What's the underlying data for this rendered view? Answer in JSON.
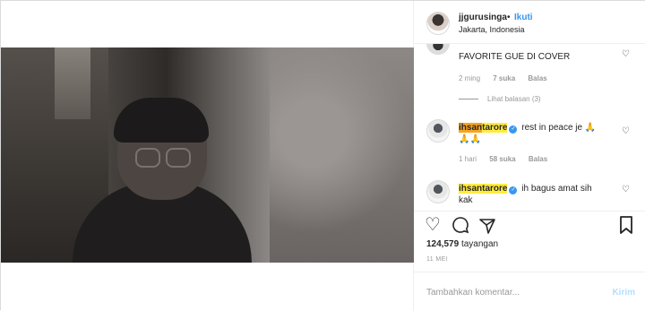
{
  "header": {
    "username": "jjgurusinga",
    "separator": "•",
    "follow_label": "Ikuti",
    "location": "Jakarta, Indonesia"
  },
  "comments": [
    {
      "text": "FAVORITE GUE DI COVER",
      "time": "2 ming",
      "likes": "7 suka",
      "reply": "Balas",
      "view_replies": "Lihat balasan (3)"
    },
    {
      "user_highlight": "ihsan",
      "user_rest": "tarore",
      "text": "rest in peace je 🙏",
      "text2": "🙏🙏",
      "time": "1 hari",
      "likes": "58 suka",
      "reply": "Balas"
    },
    {
      "user_highlight": "ihsan",
      "user_rest": "tarore",
      "text": "ih bagus amat sih",
      "text2": "kak"
    }
  ],
  "views": {
    "count": "124,579",
    "label": "tayangan"
  },
  "date": "11 MEI",
  "add_comment": {
    "placeholder": "Tambahkan komentar...",
    "post_label": "Kirim"
  },
  "icons": {
    "like": "heart-icon",
    "comment": "comment-icon",
    "share": "share-icon",
    "save": "bookmark-icon",
    "verified": "verified-badge-icon"
  },
  "colors": {
    "link": "#3897f0",
    "highlight": "#ffec3d",
    "highlight_strong": "#f7a41f",
    "muted": "#999999"
  }
}
